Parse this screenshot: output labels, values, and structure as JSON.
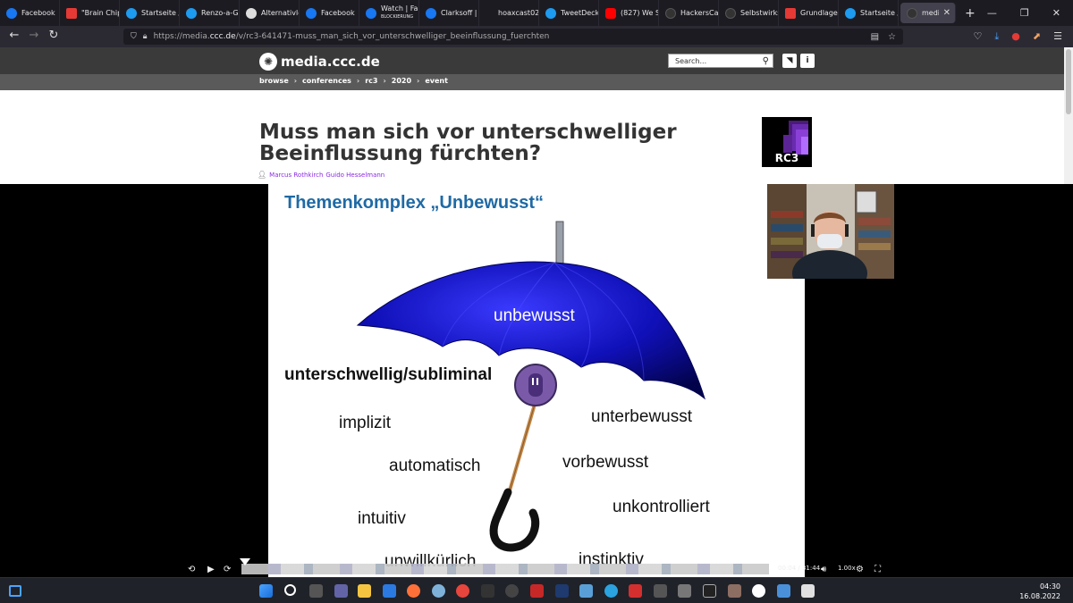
{
  "tabs": [
    {
      "label": "Facebook",
      "icon": "facebook-icon"
    },
    {
      "label": "\"Brain Chip",
      "icon": "s-app-icon"
    },
    {
      "label": "Startseite /",
      "icon": "twitter-icon"
    },
    {
      "label": "Renzo-a-Go",
      "icon": "twitter-icon"
    },
    {
      "label": "Alternativlo",
      "icon": "alternativlos-icon"
    },
    {
      "label": "Facebook",
      "icon": "facebook-icon"
    },
    {
      "label": "Watch | Fa",
      "sublabel": "BLOCKIERUNG",
      "icon": "facebook-icon"
    },
    {
      "label": "Clarksoff | T",
      "icon": "facebook-icon"
    },
    {
      "label": "hoaxcast022.mp",
      "icon": "none"
    },
    {
      "label": "TweetDeck",
      "icon": "twitter-icon"
    },
    {
      "label": "(827) We Sh",
      "icon": "youtube-icon"
    },
    {
      "label": "HackersCar",
      "icon": "github-icon"
    },
    {
      "label": "Selbstwirks",
      "icon": "blog-icon"
    },
    {
      "label": "Grundlagen",
      "icon": "red-square-icon"
    },
    {
      "label": "Startseite /",
      "icon": "twitter-icon"
    },
    {
      "label": "media.ccc",
      "icon": "ccc-icon",
      "active": true
    }
  ],
  "url": {
    "prefix": "https://media.",
    "domain": "ccc.de",
    "path": "/v/rc3-641471-muss_man_sich_vor_unterschwelliger_beeinflussung_fuerchten"
  },
  "site": {
    "logo_text": "media.ccc.de",
    "search_placeholder": "Search...",
    "breadcrumbs": [
      "browse",
      "conferences",
      "rc3",
      "2020",
      "event"
    ]
  },
  "talk": {
    "title": "Muss man sich vor unterschwelliger Beeinflussung fürchten?",
    "speakers": [
      "Marcus Rothkirch",
      "Guido Hesselmann"
    ],
    "conference_logo_text": "RC3"
  },
  "slide": {
    "title": "Themenkomplex „Unbewusst“",
    "words": {
      "unbewusst": "unbewusst",
      "unterschwellig": "unterschwellig/subliminal",
      "implizit": "implizit",
      "unterbewusst": "unterbewusst",
      "automatisch": "automatisch",
      "vorbewusst": "vorbewusst",
      "unkontrolliert": "unkontrolliert",
      "intuitiv": "intuitiv",
      "unwillkuerlich": "unwillkürlich",
      "instinktiv": "instinktiv"
    }
  },
  "player": {
    "time": "00:04 / 31:44",
    "speed": "1.00x"
  },
  "taskbar": {
    "time": "04:30",
    "date": "16.08.2022"
  }
}
